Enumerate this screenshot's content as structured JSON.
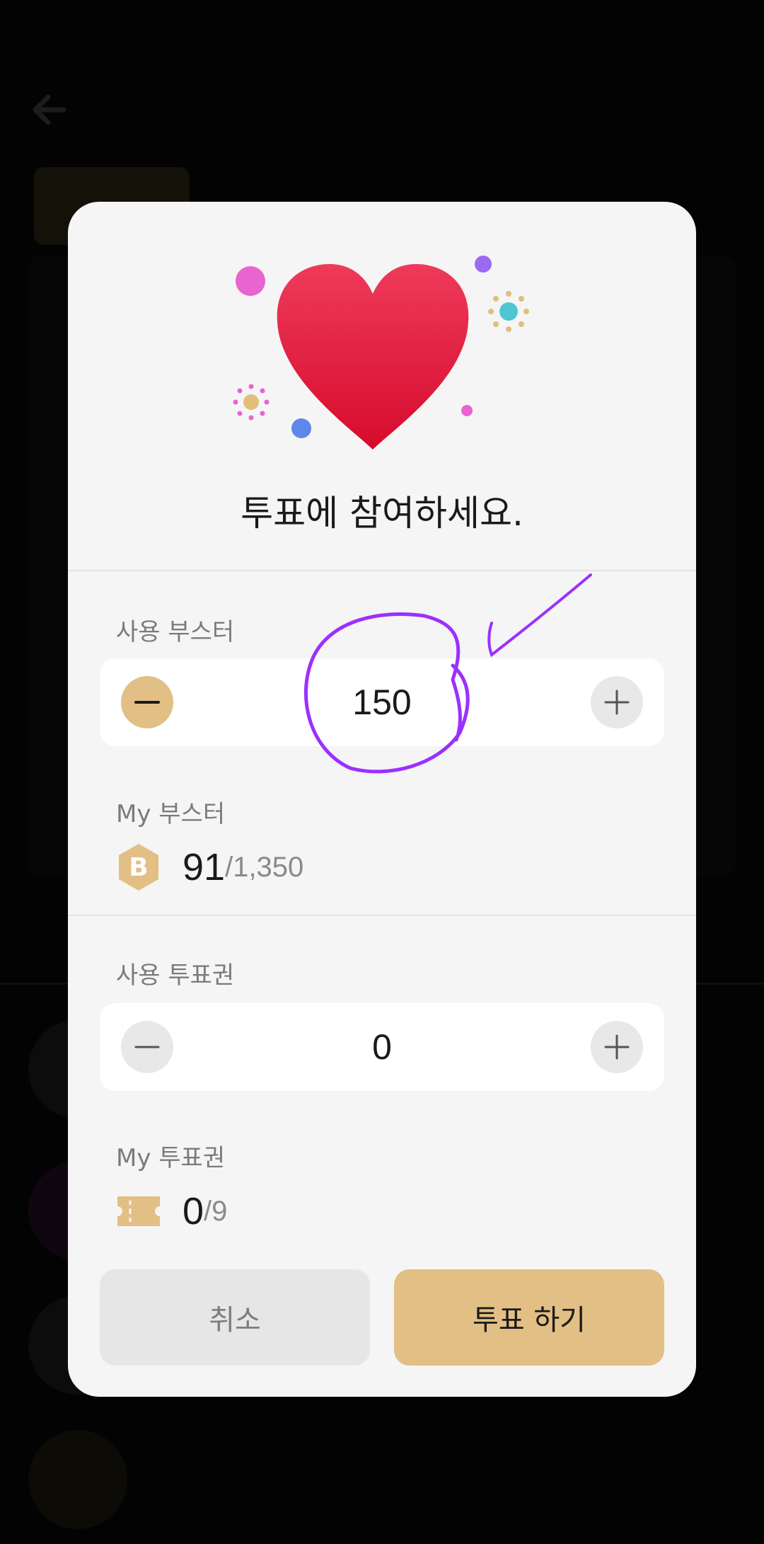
{
  "modal": {
    "headline": "투표에 참여하세요.",
    "booster_section": {
      "label": "사용 부스터",
      "value": "150"
    },
    "my_booster": {
      "label": "My 부스터",
      "badge_letter": "B",
      "current": "91",
      "total": "/1,350"
    },
    "ticket_section": {
      "label": "사용 투표권",
      "value": "0"
    },
    "my_ticket": {
      "label": "My 투표권",
      "current": "0",
      "total": "/9"
    },
    "buttons": {
      "cancel_label": "취소",
      "vote_label": "투표 하기"
    }
  },
  "icons": {
    "back": "arrow-left-icon",
    "heart": "heart-icon",
    "minus": "minus-icon",
    "plus": "plus-icon",
    "booster": "booster-hexagon-icon",
    "ticket": "ticket-icon"
  },
  "colors": {
    "accent_gold": "#e2bf84",
    "heart_red": "#e2203f",
    "modal_bg": "#f5f5f5",
    "annotation_purple": "#9b30ff"
  }
}
